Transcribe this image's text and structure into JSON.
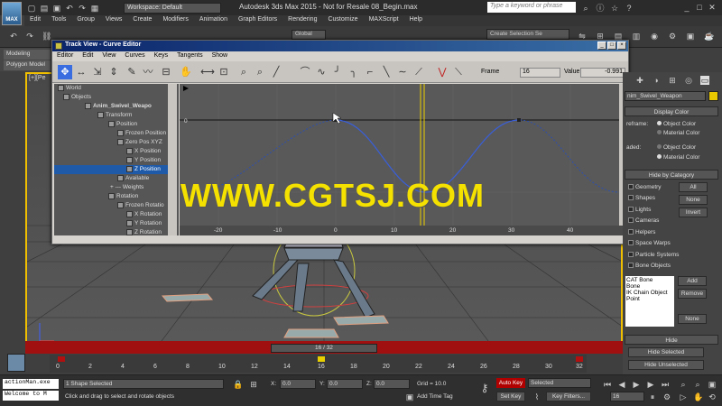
{
  "app": {
    "logo_label": "MAX",
    "workspace": "Workspace: Default",
    "title": "Autodesk 3ds Max  2015   - Not for Resale    08_Begin.max",
    "search_placeholder": "Type a keyword or phrase"
  },
  "menu": [
    "Edit",
    "Tools",
    "Group",
    "Views",
    "Create",
    "Modifiers",
    "Animation",
    "Graph Editors",
    "Rendering",
    "Customize",
    "MAXScript",
    "Help"
  ],
  "toolbar": {
    "coord_system": "Global",
    "selection_set": "Create Selection Se"
  },
  "ribbon": {
    "tab1": "Modeling",
    "tab2": "Polygon Model"
  },
  "viewport": {
    "label": "[+][Pe"
  },
  "trackview": {
    "title": "Track View - Curve Editor",
    "menu": [
      "Editor",
      "Edit",
      "View",
      "Curves",
      "Keys",
      "Tangents",
      "Show"
    ],
    "frame_label": "Frame",
    "frame_value": "16",
    "value_label": "Value",
    "value_value": "-0.991",
    "tree": [
      {
        "label": "World",
        "indent": 4
      },
      {
        "label": "Objects",
        "indent": 10
      },
      {
        "label": "Anim_Swivel_Weapo",
        "indent": 34,
        "bold": true
      },
      {
        "label": "Transform",
        "indent": 48
      },
      {
        "label": "Position",
        "indent": 60
      },
      {
        "label": "Frozen Position",
        "indent": 70
      },
      {
        "label": "Zero Pos XYZ",
        "indent": 70
      },
      {
        "label": "X Position",
        "indent": 80
      },
      {
        "label": "Y Position",
        "indent": 80
      },
      {
        "label": "Z Position",
        "indent": 80,
        "selected": true
      },
      {
        "label": "Available",
        "indent": 70
      },
      {
        "label": "Weights",
        "indent": 62,
        "prefix": "+ ---"
      },
      {
        "label": "Rotation",
        "indent": 60
      },
      {
        "label": "Frozen Rotatio",
        "indent": 70
      },
      {
        "label": "X Rotation",
        "indent": 80
      },
      {
        "label": "Y Rotation",
        "indent": 80
      },
      {
        "label": "Z Rotation",
        "indent": 80
      }
    ],
    "curve_ylabel_top": "0",
    "curve_ylabel_bottom": "-1",
    "ruler_ticks": [
      "-20",
      "-10",
      "0",
      "10",
      "20",
      "30",
      "40"
    ]
  },
  "watermark": "WWW.CGTSJ.COM",
  "command_panel": {
    "object_name": "nim_Swivel_Weapon",
    "display_color": "Display Color",
    "wireframe_label": "reframe:",
    "object_color": "Object Color",
    "material_color": "Material Color",
    "shaded_label": "aded:",
    "hide_by_category": "Hide by Category",
    "categories": [
      "Geometry",
      "Shapes",
      "Lights",
      "Cameras",
      "Helpers",
      "Space Warps",
      "Particle Systems",
      "Bone Objects"
    ],
    "btn_all": "All",
    "btn_none": "None",
    "btn_invert": "Invert",
    "list_items": [
      "CAT Bone",
      "Bone",
      "IK Chain Object",
      "Point"
    ],
    "btn_add": "Add",
    "btn_remove": "Remove",
    "btn_none2": "None",
    "hide": "Hide",
    "hide_selected": "Hide Selected",
    "hide_unselected": "Hide Unselected"
  },
  "timeline": {
    "slider": "16 / 32",
    "ticks": [
      "0",
      "2",
      "4",
      "6",
      "8",
      "10",
      "12",
      "14",
      "16",
      "18",
      "20",
      "22",
      "24",
      "26",
      "28",
      "30",
      "32"
    ]
  },
  "status": {
    "maxscript_line1": "actionMan.exe",
    "maxscript_line2": "Welcome to M",
    "selection": "1 Shape Selected",
    "prompt": "Click and drag to select and rotate objects",
    "x_label": "X:",
    "x_value": "0.0",
    "y_label": "Y:",
    "y_value": "0.0",
    "z_label": "Z:",
    "z_value": "0.0",
    "grid": "Grid = 10.0",
    "add_time_tag": "Add Time Tag",
    "auto_key": "Auto Key",
    "set_key": "Set Key",
    "selected_dropdown": "Selected",
    "key_filters": "Key Filters...",
    "frame_field": "16"
  }
}
